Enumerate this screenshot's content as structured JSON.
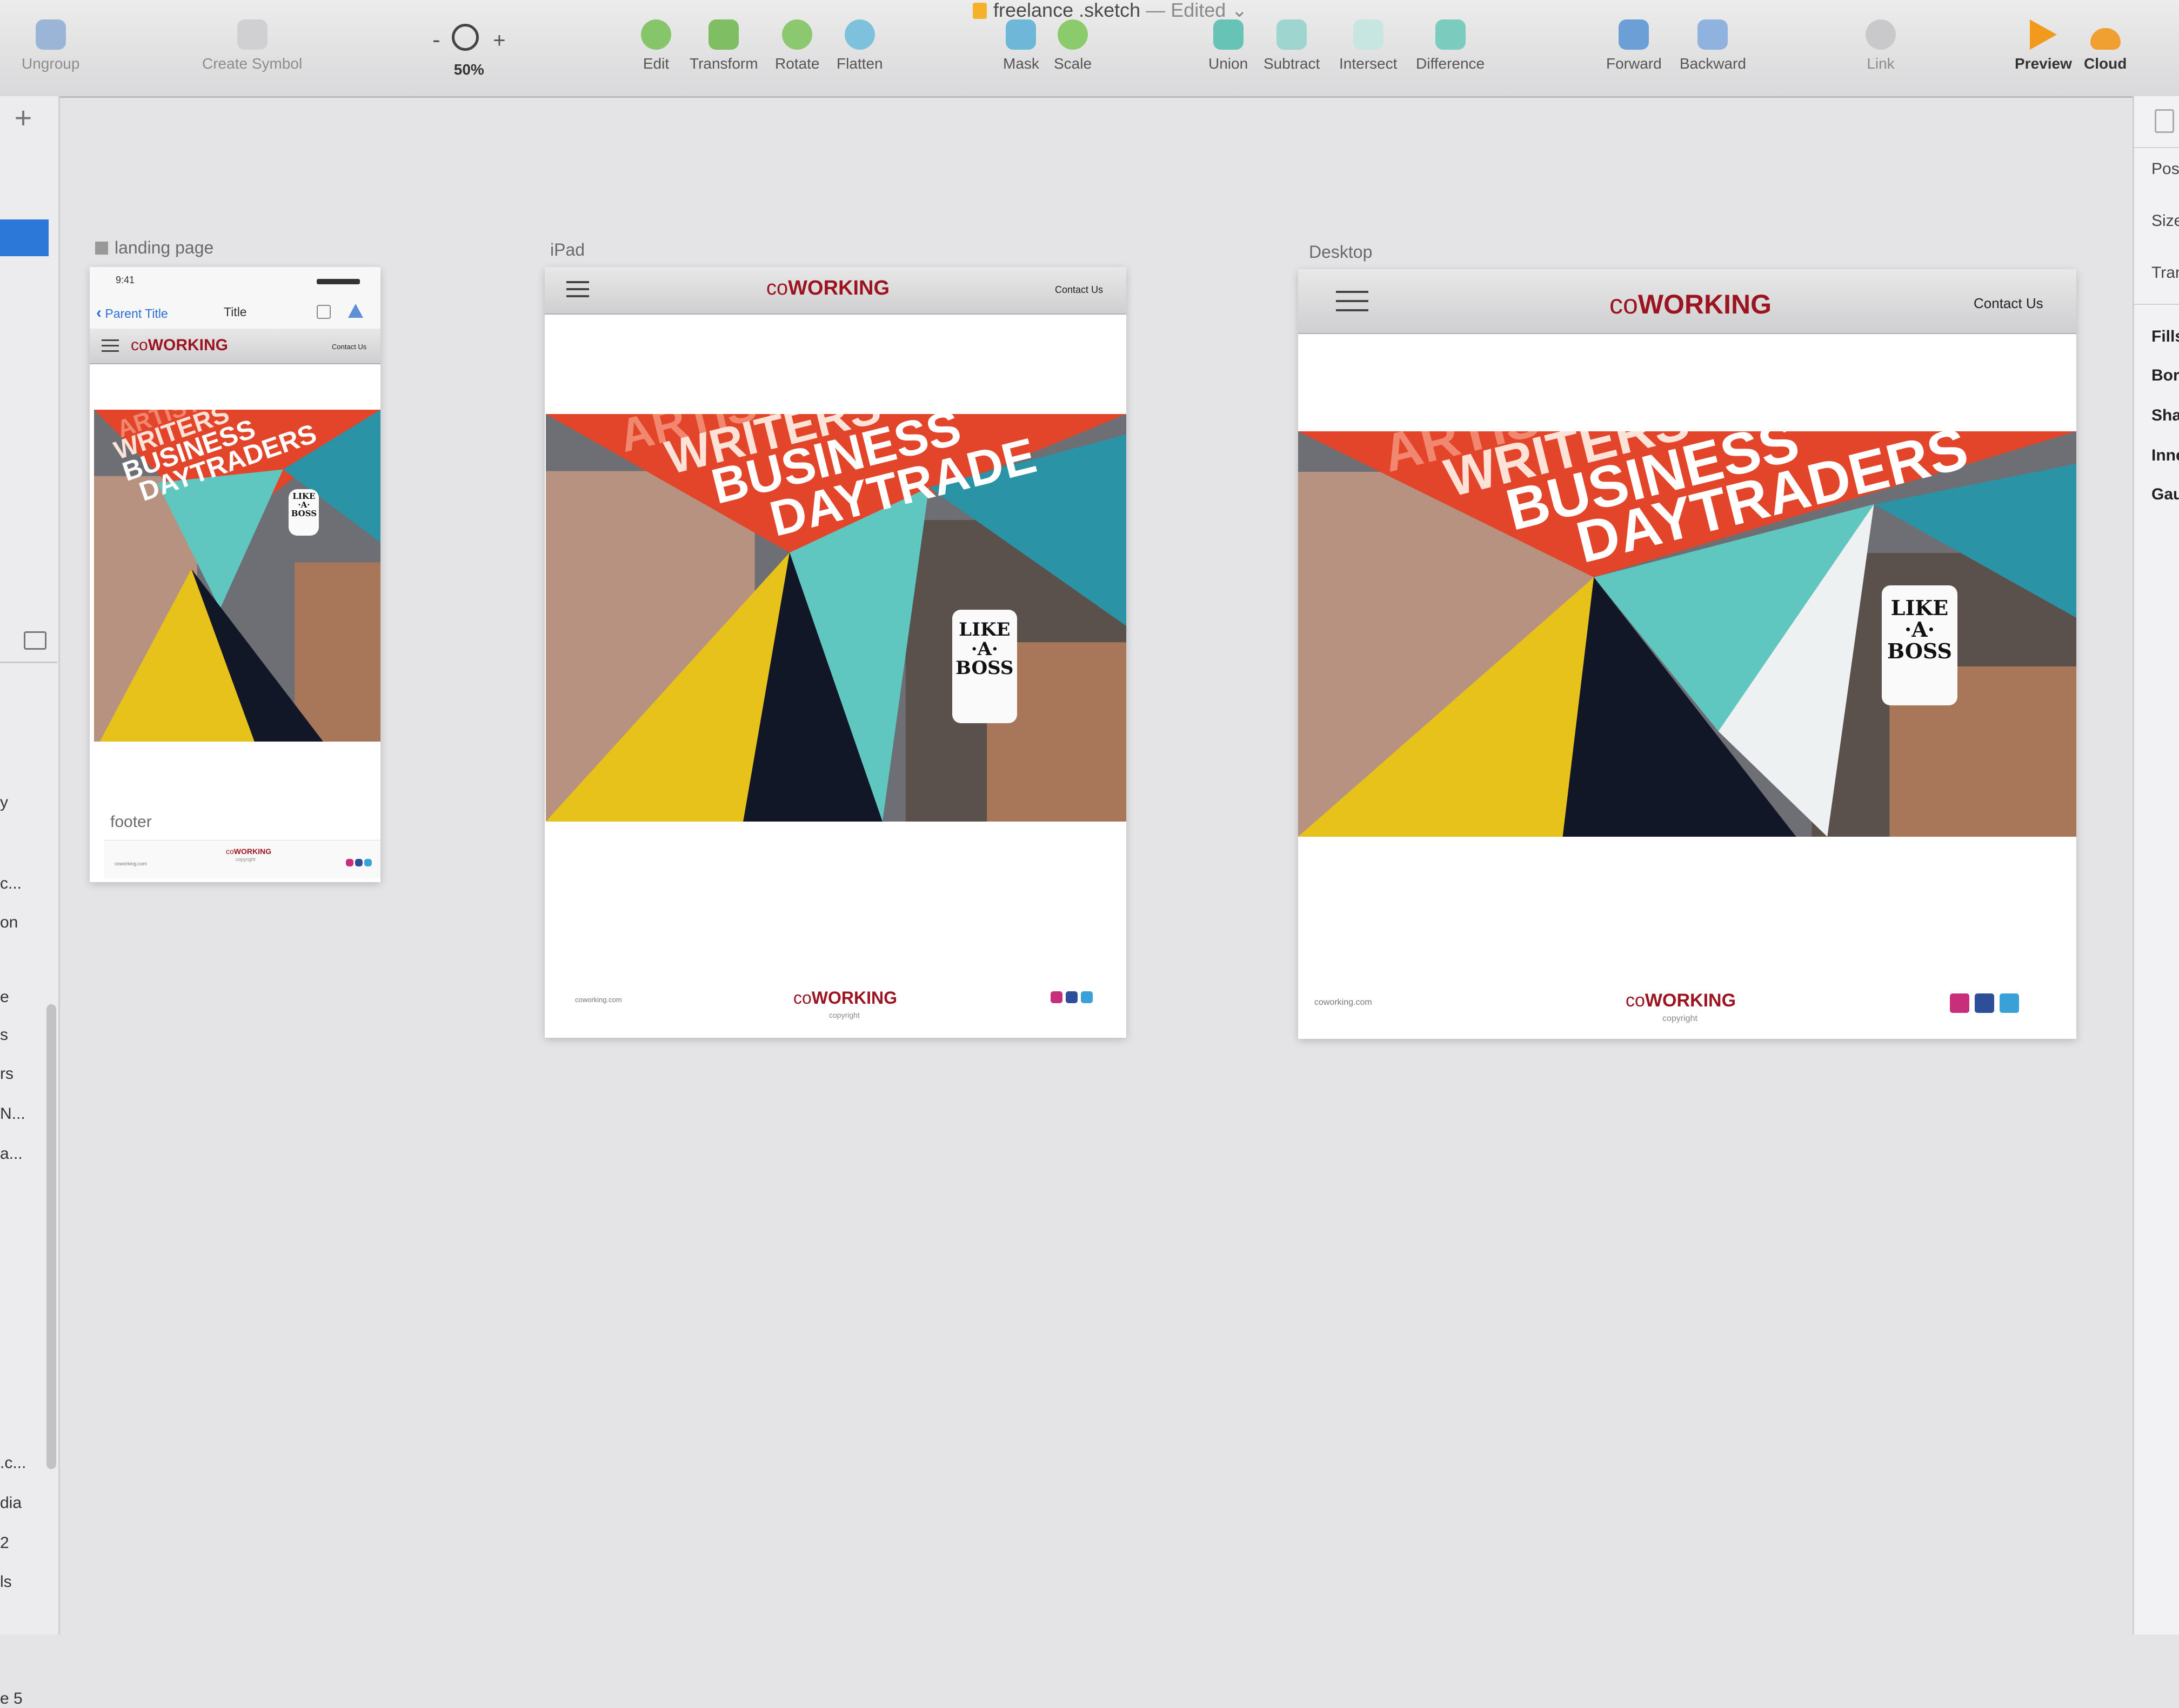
{
  "document": {
    "name": "freelance .sketch",
    "separator": "—",
    "status": "Edited",
    "chevron": "⌄"
  },
  "toolbar": [
    {
      "id": "ungroup",
      "label": "Ungroup",
      "icon": "ungroup-icon",
      "color": "#9bb5d6",
      "disabled": true
    },
    {
      "id": "create-symbol",
      "label": "Create Symbol",
      "icon": "symbol-icon",
      "color": "#c9c9cb",
      "disabled": true
    },
    {
      "id": "edit",
      "label": "Edit",
      "icon": "edit-icon",
      "color": "#86c56a"
    },
    {
      "id": "transform",
      "label": "Transform",
      "icon": "transform-icon",
      "color": "#7fbe62"
    },
    {
      "id": "rotate",
      "label": "Rotate",
      "icon": "rotate-icon",
      "color": "#8cc870"
    },
    {
      "id": "flatten",
      "label": "Flatten",
      "icon": "flatten-icon",
      "color": "#7ec1dd"
    },
    {
      "id": "mask",
      "label": "Mask",
      "icon": "mask-icon",
      "color": "#6fb7d8"
    },
    {
      "id": "scale",
      "label": "Scale",
      "icon": "scale-icon",
      "color": "#8ccb6b"
    },
    {
      "id": "union",
      "label": "Union",
      "icon": "union-icon",
      "color": "#66c3b5"
    },
    {
      "id": "subtract",
      "label": "Subtract",
      "icon": "subtract-icon",
      "color": "#9fd5cf"
    },
    {
      "id": "intersect",
      "label": "Intersect",
      "icon": "intersect-icon",
      "color": "#c7e6e2"
    },
    {
      "id": "difference",
      "label": "Difference",
      "icon": "difference-icon",
      "color": "#7ccbbf"
    },
    {
      "id": "forward",
      "label": "Forward",
      "icon": "forward-icon",
      "color": "#6c9fd6"
    },
    {
      "id": "backward",
      "label": "Backward",
      "icon": "backward-icon",
      "color": "#8fb3de"
    },
    {
      "id": "link",
      "label": "Link",
      "icon": "link-icon",
      "color": "#c9c9cb",
      "disabled": true
    },
    {
      "id": "preview",
      "label": "Preview",
      "icon": "preview-play-icon",
      "color": "#f29a1c"
    },
    {
      "id": "cloud",
      "label": "Cloud",
      "icon": "cloud-icon",
      "color": "#f0a030"
    }
  ],
  "zoom": {
    "minus": "-",
    "plus": "+",
    "value": "50%"
  },
  "left_panel": {
    "add": "+",
    "items": [
      "y",
      "c...",
      "on",
      "e",
      "s",
      "rs",
      "N...",
      "a...",
      ".c...",
      "dia",
      "2",
      "ls",
      "e 5"
    ]
  },
  "right_panel": {
    "plain": [
      "Posi",
      "Size",
      "Tran"
    ],
    "bold": [
      "Fills",
      "Bord",
      "Shac",
      "Inne",
      "Gaus"
    ]
  },
  "artboards": {
    "phone_label": "landing page",
    "ipad_label": "iPad",
    "desktop_label": "Desktop",
    "footer_label": "footer"
  },
  "phone": {
    "time": "9:41",
    "back": "Parent Title",
    "title": "Title"
  },
  "site": {
    "logo_co": "co",
    "logo_main": "WORKING",
    "contact": "Contact Us",
    "url": "coworking.com",
    "copyright": "copyright"
  },
  "hero_words": {
    "artist": "ARTIST",
    "artists": "ARTISTS",
    "writers": "WRITERS",
    "business": "BUSINESS",
    "daytraders": "DAYTRADERS",
    "daytrade": "DAYTRADE"
  },
  "mug": {
    "line1": "LIKE",
    "line2": "·A·",
    "line3": "BOSS"
  },
  "colors": {
    "brand": "#9b1420",
    "orange": "#e2452a",
    "teal": "#2b93a6",
    "mint": "#5fc6c0",
    "yellow": "#e6c21a",
    "navy": "#111726"
  }
}
